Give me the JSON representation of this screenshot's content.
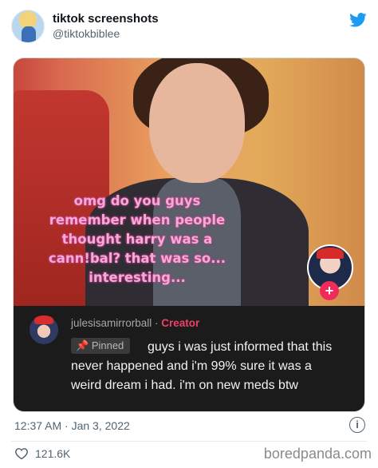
{
  "tweet": {
    "author_name": "tiktok screenshots",
    "author_handle": "@tiktokbiblee",
    "timestamp": "12:37 AM · Jan 3, 2022",
    "likes": "121.6K",
    "brand_color": "#1d9bf0"
  },
  "tiktok": {
    "overlay_text": "omg do you guys\nremember when people\nthought harry was a\ncann!bal? that was so...\ninteresting...",
    "comment": {
      "username": "julesisamirrorball",
      "separator": " · ",
      "badge": "Creator",
      "pinned_label": "Pinned",
      "text": "guys i was just informed that this never happened and i'm 99% sure it was a weird dream i had. i'm on new meds btw"
    },
    "plus_label": "+"
  },
  "watermark": "boredpanda.com",
  "icons": {
    "twitter": "twitter-bird-icon",
    "info": "info-icon",
    "heart": "heart-icon",
    "pin": "pin-icon"
  }
}
